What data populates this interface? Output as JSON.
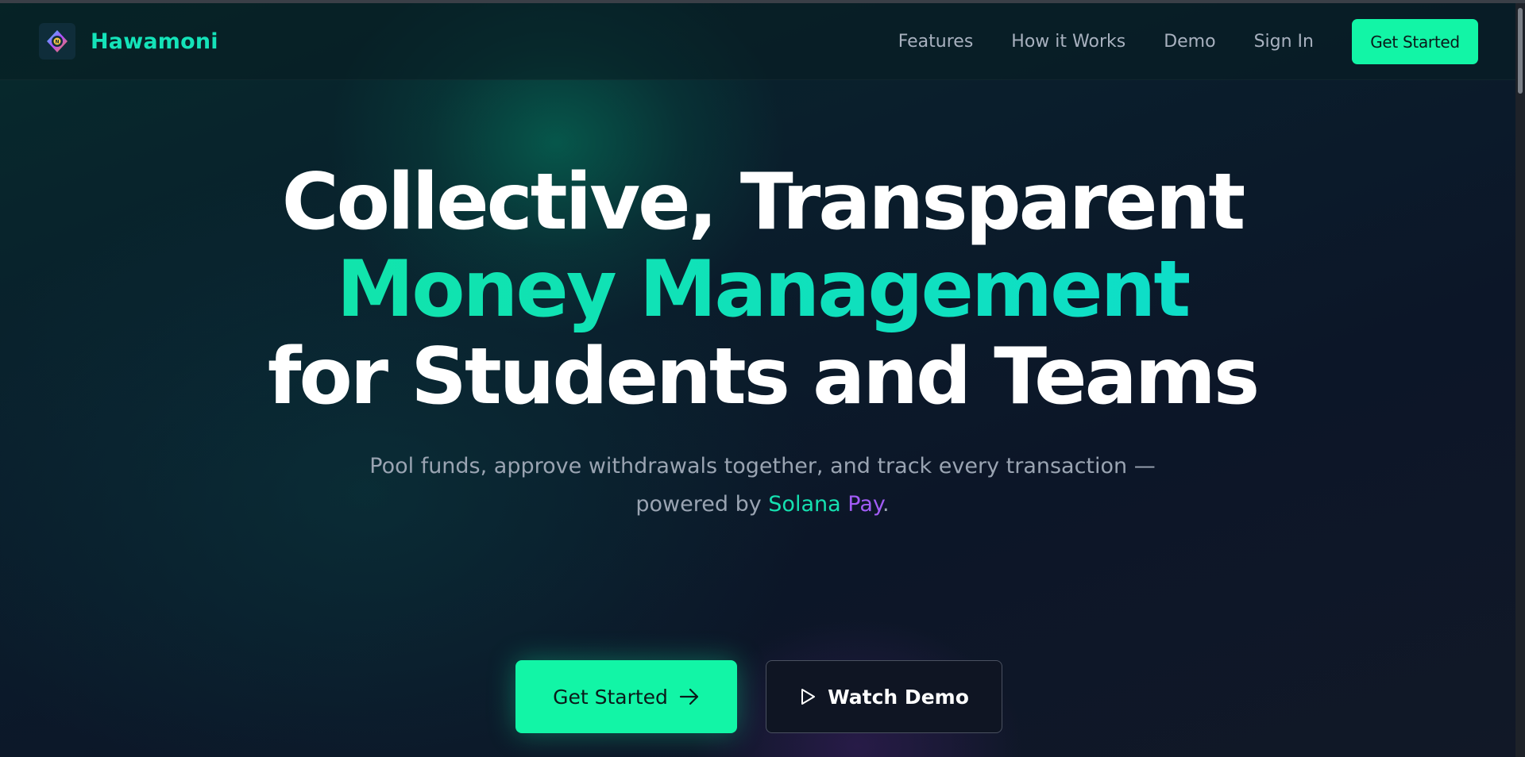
{
  "brand": {
    "name": "Hawamoni",
    "logo_icon": "hawamoni-logo-icon"
  },
  "nav": {
    "links": [
      "Features",
      "How it Works",
      "Demo",
      "Sign In"
    ],
    "cta_label": "Get Started"
  },
  "hero": {
    "title_line1": "Collective, Transparent",
    "title_line2": "Money Management",
    "title_line3": "for Students and Teams",
    "subtitle_line1": "Pool funds, approve withdrawals together, and track every transaction —",
    "subtitle_prefix": "powered by ",
    "subtitle_solana": "Solana",
    "subtitle_space": " ",
    "subtitle_pay": "Pay",
    "subtitle_suffix": "."
  },
  "cta": {
    "primary_label": "Get Started",
    "primary_icon": "arrow-right-icon",
    "secondary_label": "Watch Demo",
    "secondary_icon": "play-icon"
  },
  "colors": {
    "accent": "#12f5a6",
    "brand_text": "#14e3b9",
    "solana": "#15e0b0",
    "pay": "#a25cf5",
    "background": "#0b1424"
  }
}
